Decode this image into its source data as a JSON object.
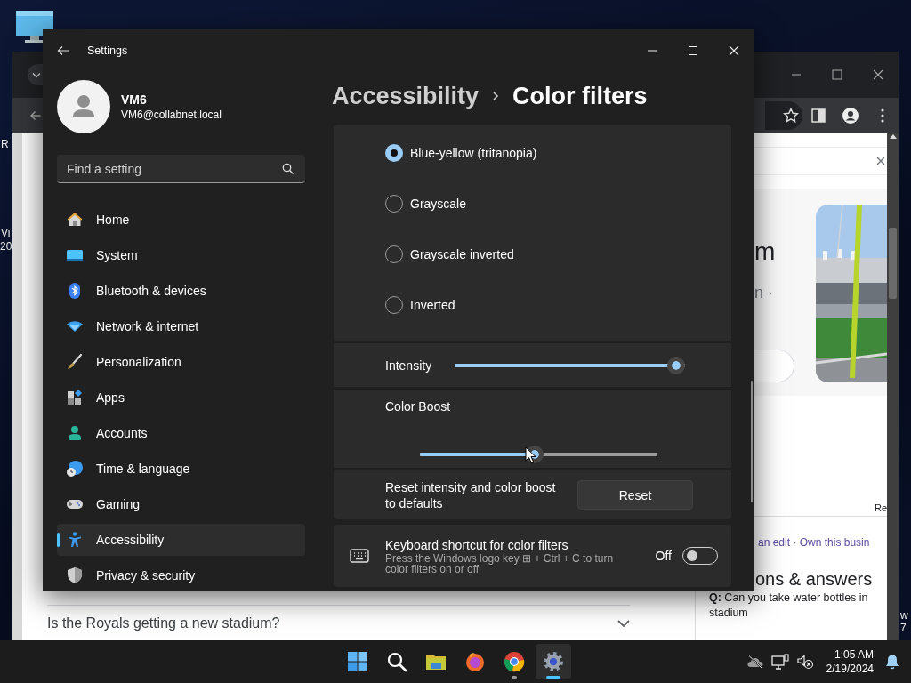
{
  "desktop": {
    "label_fragments": [
      "R",
      "Vi",
      "20",
      "w",
      "7"
    ]
  },
  "browser": {
    "card_title_fragment": "m",
    "card_subtitle_fragment": "n ·",
    "image_credit_fragment": "Re",
    "links": [
      "an edit",
      "Own this busin"
    ],
    "link_separator": "·",
    "section_title_fragment": "ons & answers",
    "question": "**Q:** Can you take water bottles in\nstadium",
    "faq": [
      {
        "question": "Is the Royals getting a new stadium?",
        "expanded": false
      }
    ]
  },
  "settings": {
    "window": {
      "title": "Settings"
    },
    "user": {
      "name": "VM6",
      "email": "VM6@collabnet.local"
    },
    "search": {
      "placeholder": "Find a setting"
    },
    "nav": [
      {
        "label": "Home",
        "selected": false
      },
      {
        "label": "System",
        "selected": false
      },
      {
        "label": "Bluetooth & devices",
        "selected": false
      },
      {
        "label": "Network & internet",
        "selected": false
      },
      {
        "label": "Personalization",
        "selected": false
      },
      {
        "label": "Apps",
        "selected": false
      },
      {
        "label": "Accounts",
        "selected": false
      },
      {
        "label": "Time & language",
        "selected": false
      },
      {
        "label": "Gaming",
        "selected": false
      },
      {
        "label": "Accessibility",
        "selected": true
      },
      {
        "label": "Privacy & security",
        "selected": false
      }
    ],
    "breadcrumb": [
      "Accessibility",
      "Color filters"
    ],
    "filters": [
      {
        "label": "Blue-yellow (tritanopia)",
        "selected": true
      },
      {
        "label": "Grayscale",
        "selected": false
      },
      {
        "label": "Grayscale inverted",
        "selected": false
      },
      {
        "label": "Inverted",
        "selected": false
      }
    ],
    "sliders": [
      {
        "kind": "inline",
        "label": "Intensity",
        "level": 1
      },
      {
        "kind": "stacked",
        "label": "Color Boost",
        "level": 0.48
      }
    ],
    "reset": {
      "text": "Reset intensity and color boost to defaults",
      "button": "Reset"
    },
    "shortcut": {
      "title": "Keyboard shortcut for color filters",
      "description": "Press the Windows logo key ⊞ + Ctrl + C to turn color filters on or off",
      "state_label": "Off",
      "on": false
    }
  },
  "taskbar": {
    "apps": [
      {
        "selected": false,
        "running": false
      },
      {
        "selected": false,
        "running": false
      },
      {
        "selected": false,
        "running": false
      },
      {
        "selected": false,
        "running": false
      },
      {
        "selected": false,
        "running": true
      },
      {
        "selected": true,
        "running": true
      }
    ],
    "clock": {
      "time": "1:05 AM",
      "date": "2/19/2024"
    }
  }
}
